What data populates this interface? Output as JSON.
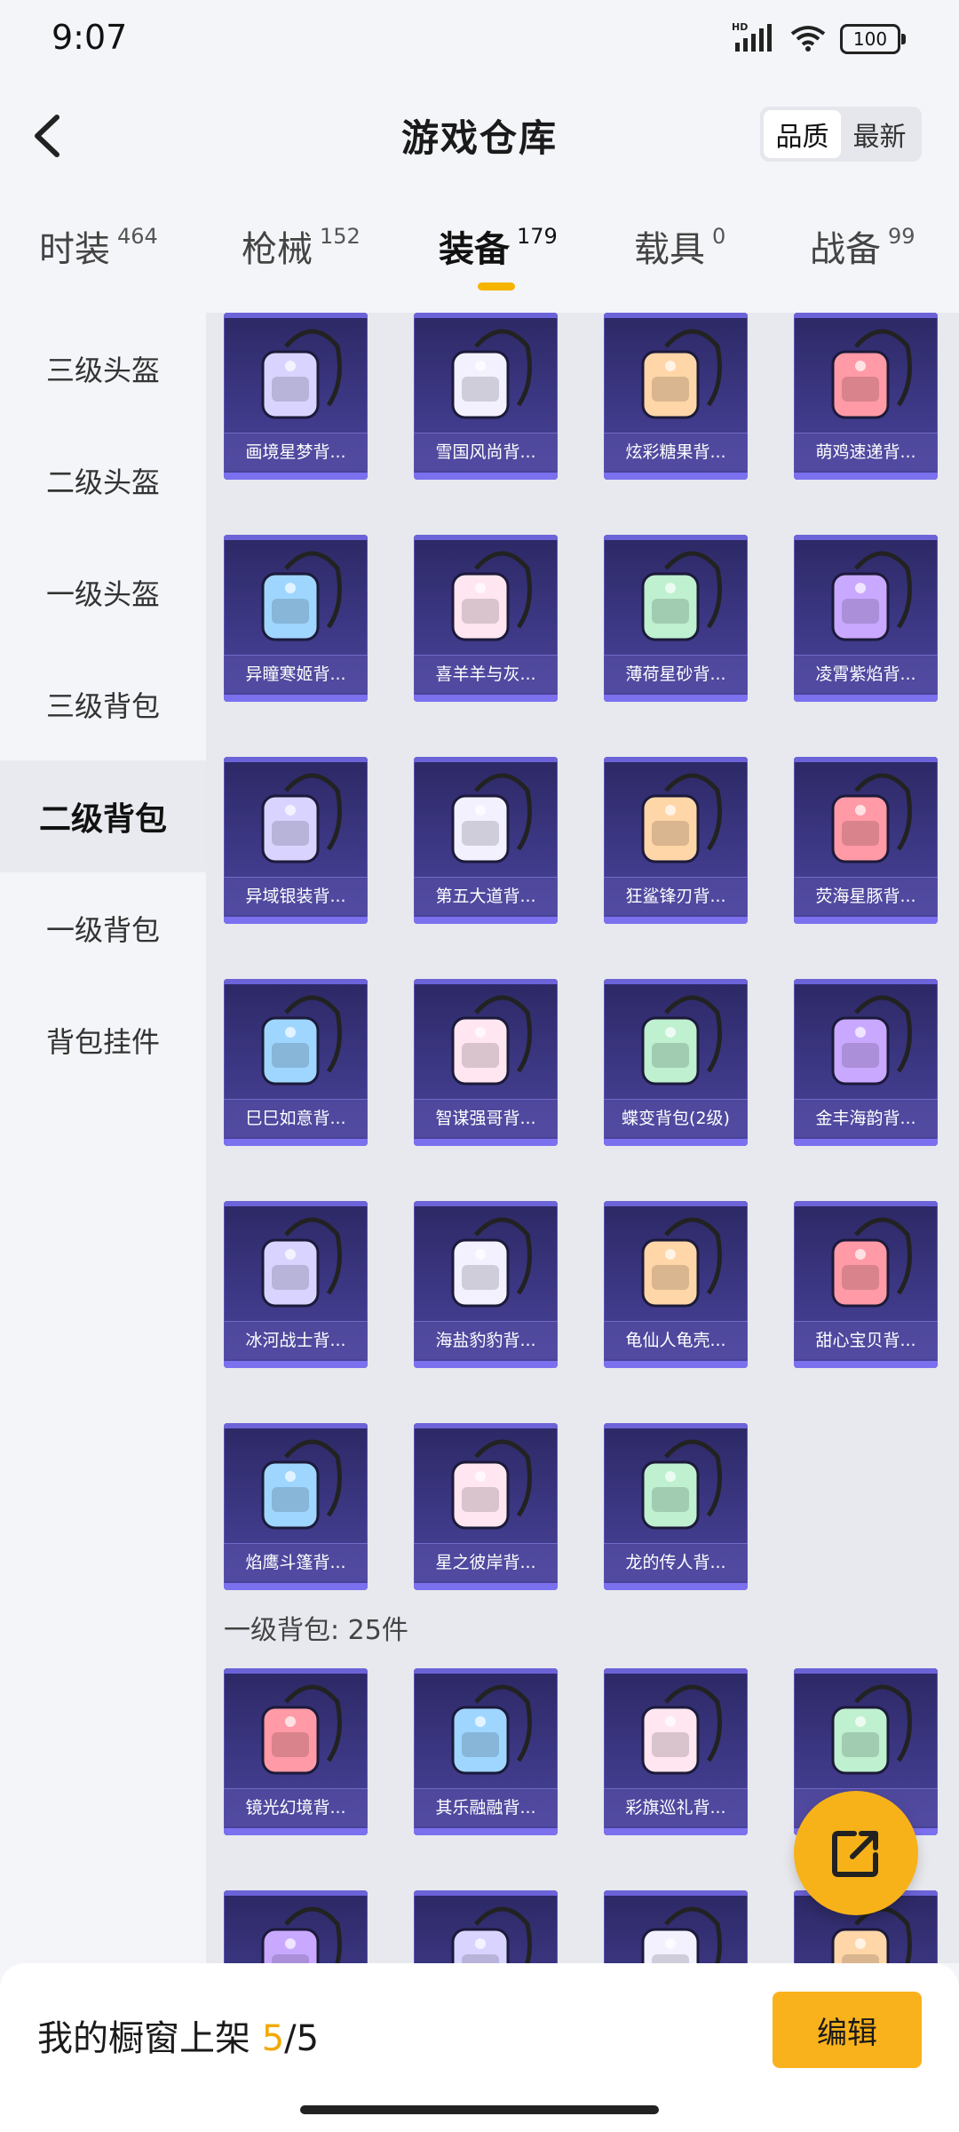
{
  "status_bar": {
    "time": "9:07",
    "network": "HD",
    "battery": "100"
  },
  "header": {
    "title": "游戏仓库",
    "sort_options": [
      {
        "label": "品质",
        "active": true
      },
      {
        "label": "最新",
        "active": false
      }
    ]
  },
  "category_tabs": [
    {
      "name": "时装",
      "count": "464"
    },
    {
      "name": "枪械",
      "count": "152"
    },
    {
      "name": "装备",
      "count": "179",
      "active": true
    },
    {
      "name": "载具",
      "count": "0"
    },
    {
      "name": "战备",
      "count": "99"
    }
  ],
  "sidebar": {
    "items": [
      {
        "label": "三级头盔"
      },
      {
        "label": "二级头盔"
      },
      {
        "label": "一级头盔"
      },
      {
        "label": "三级背包"
      },
      {
        "label": "二级背包",
        "active": true
      },
      {
        "label": "一级背包"
      },
      {
        "label": "背包挂件"
      }
    ]
  },
  "grid": {
    "items": [
      {
        "name": "画境星梦背...",
        "icon": "backpack-icon"
      },
      {
        "name": "雪国风尚背...",
        "icon": "backpack-icon"
      },
      {
        "name": "炫彩糖果背...",
        "icon": "backpack-icon"
      },
      {
        "name": "萌鸡速递背...",
        "icon": "backpack-icon"
      },
      {
        "name": "异瞳寒姬背...",
        "icon": "backpack-icon"
      },
      {
        "name": "喜羊羊与灰...",
        "icon": "backpack-icon"
      },
      {
        "name": "薄荷星砂背...",
        "icon": "backpack-icon"
      },
      {
        "name": "凌霄紫焰背...",
        "icon": "backpack-icon"
      },
      {
        "name": "异域银装背...",
        "icon": "backpack-icon"
      },
      {
        "name": "第五大道背...",
        "icon": "backpack-icon"
      },
      {
        "name": "狂鲨锋刃背...",
        "icon": "backpack-icon"
      },
      {
        "name": "荧海星豚背...",
        "icon": "backpack-icon"
      },
      {
        "name": "巳巳如意背...",
        "icon": "backpack-icon"
      },
      {
        "name": "智谋强哥背...",
        "icon": "backpack-icon"
      },
      {
        "name": "蝶变背包(2级)",
        "icon": "backpack-icon"
      },
      {
        "name": "金丰海韵背...",
        "icon": "backpack-icon"
      },
      {
        "name": "冰河战士背...",
        "icon": "backpack-icon"
      },
      {
        "name": "海盐豹豹背...",
        "icon": "backpack-icon"
      },
      {
        "name": "龟仙人龟壳...",
        "icon": "backpack-icon"
      },
      {
        "name": "甜心宝贝背...",
        "icon": "backpack-icon"
      },
      {
        "name": "焰鹰斗篷背...",
        "icon": "backpack-icon"
      },
      {
        "name": "星之彼岸背...",
        "icon": "backpack-icon"
      },
      {
        "name": "龙的传人背...",
        "icon": "backpack-icon"
      }
    ],
    "section2_label": "一级背包: 25件",
    "section2_items": [
      {
        "name": "镜光幻境背...",
        "icon": "backpack-icon"
      },
      {
        "name": "其乐融融背...",
        "icon": "backpack-icon"
      },
      {
        "name": "彩旗巡礼背...",
        "icon": "backpack-icon"
      },
      {
        "name": "",
        "icon": "backpack-icon"
      },
      {
        "name": "",
        "icon": "backpack-icon"
      },
      {
        "name": "",
        "icon": "backpack-icon"
      },
      {
        "name": "",
        "icon": "backpack-icon"
      },
      {
        "name": "",
        "icon": "backpack-icon"
      }
    ]
  },
  "bottom_bar": {
    "showcase_prefix": "我的橱窗上架 ",
    "showcase_current": "5",
    "showcase_total": "/5",
    "edit_label": "编辑"
  },
  "colors": {
    "accent": "#f4b400",
    "card_bg": "#3a3680"
  }
}
